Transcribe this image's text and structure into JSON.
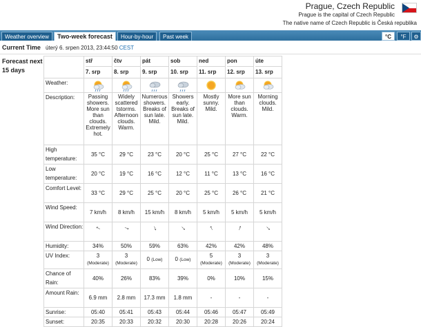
{
  "header": {
    "city": "Prague, Czech Republic",
    "line1": "Prague is the capital of Czech Republic",
    "line2": "The native name of Czech Republic is Česká republika"
  },
  "tabs": [
    "Weather overview",
    "Two-week forecast",
    "Hour-by-hour",
    "Past week"
  ],
  "units": {
    "c": "°C",
    "f": "°F",
    "gear": "⚙"
  },
  "current": {
    "label": "Current Time",
    "value": "úterý 6. srpen 2013, 23:44:50",
    "zone": "CEST"
  },
  "forecast_label": "Forecast next 15 days",
  "row_labels": {
    "weather": "Weather:",
    "description": "Description:",
    "high": "High temperature:",
    "low": "Low temperature:",
    "comfort": "Comfort Level:",
    "wind_speed": "Wind Speed:",
    "wind_dir": "Wind Direction:",
    "humidity": "Humidity:",
    "uv": "UV Index:",
    "rain_chance": "Chance of Rain:",
    "rain_amount": "Amount Rain:",
    "sunrise": "Sunrise:",
    "sunset": "Sunset:"
  },
  "days": [
    {
      "name": "stř",
      "date": "7. srp",
      "icon": "sun-cloud-rain",
      "desc": "Passing showers. More sun than clouds. Extremely hot.",
      "high": "35 °C",
      "low": "20 °C",
      "comfort": "33 °C",
      "wind": "7 km/h",
      "wind_deg": 300,
      "humidity": "34%",
      "uv": "3",
      "uv_level": "(Moderate)",
      "rain_chance": "40%",
      "rain_amount": "6.9 mm",
      "sunrise": "05:40",
      "sunset": "20:35"
    },
    {
      "name": "čtv",
      "date": "8. srp",
      "icon": "sun-cloud-rain",
      "desc": "Widely scattered tstorms. Afternoon clouds. Warm.",
      "high": "29 °C",
      "low": "19 °C",
      "comfort": "29 °C",
      "wind": "8 km/h",
      "wind_deg": 115,
      "humidity": "50%",
      "uv": "3",
      "uv_level": "(Moderate)",
      "rain_chance": "26%",
      "rain_amount": "2.8 mm",
      "sunrise": "05:41",
      "sunset": "20:33"
    },
    {
      "name": "pát",
      "date": "9. srp",
      "icon": "cloud-rain",
      "desc": "Numerous showers. Breaks of sun late. Mild.",
      "high": "23 °C",
      "low": "16 °C",
      "comfort": "25 °C",
      "wind": "15 km/h",
      "wind_deg": 160,
      "humidity": "59%",
      "uv": "0",
      "uv_level": "(Low)",
      "rain_chance": "83%",
      "rain_amount": "17.3 mm",
      "sunrise": "05:43",
      "sunset": "20:32"
    },
    {
      "name": "sob",
      "date": "10. srp",
      "icon": "cloud-rain",
      "desc": "Showers early. Breaks of sun late. Mild.",
      "high": "20 °C",
      "low": "12 °C",
      "comfort": "20 °C",
      "wind": "8 km/h",
      "wind_deg": 135,
      "humidity": "63%",
      "uv": "0",
      "uv_level": "(Low)",
      "rain_chance": "39%",
      "rain_amount": "1.8 mm",
      "sunrise": "05:44",
      "sunset": "20:30"
    },
    {
      "name": "ned",
      "date": "11. srp",
      "icon": "sun",
      "desc": "Mostly sunny. Mild.",
      "high": "25 °C",
      "low": "11 °C",
      "comfort": "25 °C",
      "wind": "5 km/h",
      "wind_deg": 335,
      "humidity": "42%",
      "uv": "5",
      "uv_level": "(Moderate)",
      "rain_chance": "0%",
      "rain_amount": "-",
      "sunrise": "05:46",
      "sunset": "20:28"
    },
    {
      "name": "pon",
      "date": "12. srp",
      "icon": "sun-cloud",
      "desc": "More sun than clouds. Warm.",
      "high": "27 °C",
      "low": "13 °C",
      "comfort": "26 °C",
      "wind": "5 km/h",
      "wind_deg": 20,
      "humidity": "42%",
      "uv": "3",
      "uv_level": "(Moderate)",
      "rain_chance": "10%",
      "rain_amount": "-",
      "sunrise": "05:47",
      "sunset": "20:26"
    },
    {
      "name": "úte",
      "date": "13. srp",
      "icon": "sun-cloud",
      "desc": "Morning clouds. Mild.",
      "high": "22 °C",
      "low": "16 °C",
      "comfort": "21 °C",
      "wind": "5 km/h",
      "wind_deg": 135,
      "humidity": "48%",
      "uv": "3",
      "uv_level": "(Moderate)",
      "rain_chance": "15%",
      "rain_amount": "-",
      "sunrise": "05:49",
      "sunset": "20:24"
    }
  ]
}
